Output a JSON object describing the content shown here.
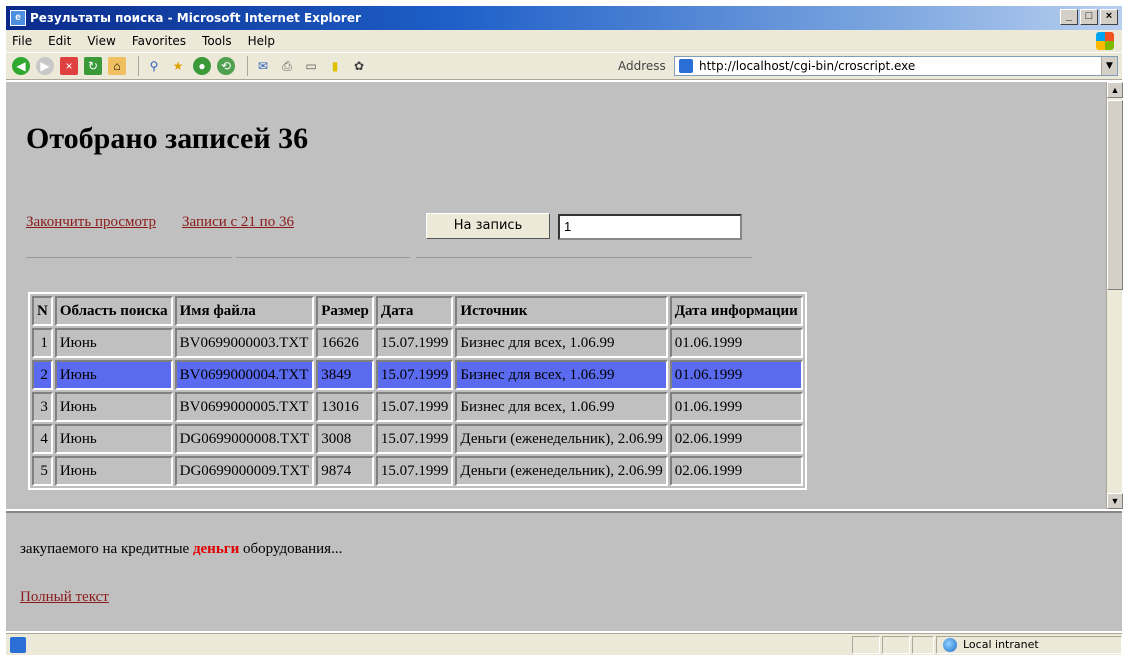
{
  "window": {
    "title": "Результаты поиска - Microsoft Internet Explorer"
  },
  "menu": [
    "File",
    "Edit",
    "View",
    "Favorites",
    "Tools",
    "Help"
  ],
  "toolbar": {
    "address_label": "Address",
    "address_value": "http://localhost/cgi-bin/croscript.exe"
  },
  "page": {
    "title": "Отобрано записей 36",
    "finish_link": "Закончить просмотр",
    "range_link": "Записи с 21 по 36",
    "goto_button": "На запись",
    "goto_value": "1"
  },
  "table": {
    "headers": [
      "N",
      "Область поиска",
      "Имя файла",
      "Размер",
      "Дата",
      "Источник",
      "Дата информации"
    ],
    "rows": [
      [
        "1",
        "Июнь",
        "BV0699000003.TXT",
        "16626",
        "15.07.1999",
        "Бизнес для всех, 1.06.99",
        "01.06.1999"
      ],
      [
        "2",
        "Июнь",
        "BV0699000004.TXT",
        "3849",
        "15.07.1999",
        "Бизнес для всех, 1.06.99",
        "01.06.1999"
      ],
      [
        "3",
        "Июнь",
        "BV0699000005.TXT",
        "13016",
        "15.07.1999",
        "Бизнес для всех, 1.06.99",
        "01.06.1999"
      ],
      [
        "4",
        "Июнь",
        "DG0699000008.TXT",
        "3008",
        "15.07.1999",
        "Деньги (еженедельник), 2.06.99",
        "02.06.1999"
      ],
      [
        "5",
        "Июнь",
        "DG0699000009.TXT",
        "9874",
        "15.07.1999",
        "Деньги (еженедельник), 2.06.99",
        "02.06.1999"
      ]
    ],
    "selected_row": 2,
    "selected_color": "#5b6bf0"
  },
  "lower": {
    "snippet_before": "закупаемого на кредитные ",
    "snippet_highlight": "деньги",
    "snippet_after": " оборудования...",
    "full_text_link": "Полный текст"
  },
  "status": {
    "zone": "Local intranet"
  }
}
